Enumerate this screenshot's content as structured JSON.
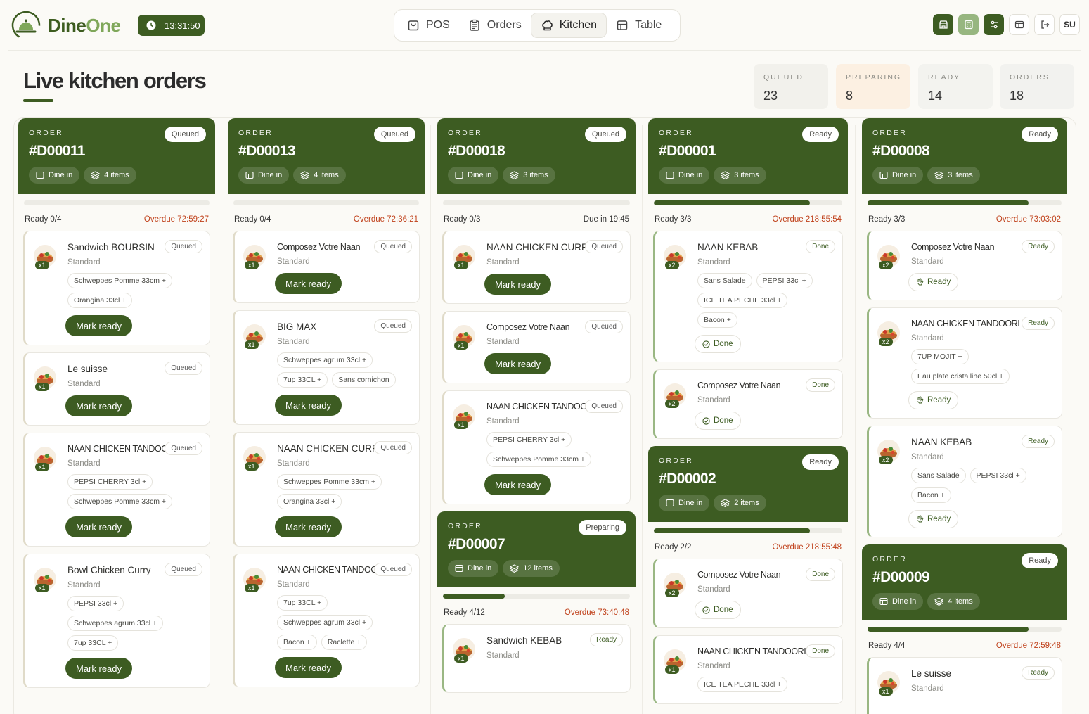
{
  "app": {
    "name_part1": "Dine",
    "name_part2": "One",
    "time": "13:31:50"
  },
  "nav": {
    "tabs": [
      {
        "label": "POS"
      },
      {
        "label": "Orders"
      },
      {
        "label": "Kitchen"
      },
      {
        "label": "Table"
      }
    ],
    "active": "Kitchen"
  },
  "user": {
    "initials": "SU"
  },
  "page": {
    "title": "Live kitchen orders"
  },
  "stats": [
    {
      "label": "QUEUED",
      "value": "23"
    },
    {
      "label": "PREPARING",
      "value": "8"
    },
    {
      "label": "READY",
      "value": "14"
    },
    {
      "label": "ORDERS",
      "value": "18"
    }
  ],
  "labels": {
    "order": "ORDER",
    "dine_in": "Dine in",
    "mark_ready": "Mark ready",
    "done": "Done",
    "ready": "Ready"
  },
  "columns": [
    {
      "orders": [
        {
          "number": "#D00011",
          "status": "Queued",
          "dine": "Dine in",
          "items_count": "4 items",
          "progress": 0,
          "ready": "Ready 0/4",
          "due": "Overdue 72:59:27",
          "overdue": true,
          "items": [
            {
              "name": "Sandwich BOURSIN",
              "variant": "Standard",
              "qty": "x1",
              "status": "Queued",
              "mods": [
                "Schweppes Pomme 33cm +",
                "Orangina 33cl +"
              ],
              "action": "Mark ready"
            },
            {
              "name": "Le suisse",
              "variant": "Standard",
              "qty": "x1",
              "status": "Queued",
              "mods": [],
              "action": "Mark ready"
            },
            {
              "name": "NAAN CHICKEN TANDOORI",
              "variant": "Standard",
              "qty": "x1",
              "status": "Queued",
              "mods": [
                "PEPSI CHERRY 3cl +",
                "Schweppes Pomme 33cm +"
              ],
              "action": "Mark ready"
            },
            {
              "name": "Bowl Chicken Curry",
              "variant": "Standard",
              "qty": "x1",
              "status": "Queued",
              "mods": [
                "PEPSI 33cl +",
                "Schweppes agrum 33cl +",
                "7up 33CL +"
              ],
              "action": "Mark ready"
            }
          ]
        }
      ]
    },
    {
      "orders": [
        {
          "number": "#D00013",
          "status": "Queued",
          "dine": "Dine in",
          "items_count": "4 items",
          "progress": 0,
          "ready": "Ready 0/4",
          "due": "Overdue 72:36:21",
          "overdue": true,
          "items": [
            {
              "name": "Composez Votre Naan",
              "variant": "Standard",
              "qty": "x1",
              "status": "Queued",
              "mods": [],
              "action": "Mark ready"
            },
            {
              "name": "BIG MAX",
              "variant": "Standard",
              "qty": "x1",
              "status": "Queued",
              "mods": [
                "Schweppes agrum 33cl +",
                "7up 33CL +",
                "Sans cornichon"
              ],
              "action": "Mark ready"
            },
            {
              "name": "NAAN CHICKEN CURRY",
              "variant": "Standard",
              "qty": "x1",
              "status": "Queued",
              "mods": [
                "Schweppes Pomme 33cm +",
                "Orangina 33cl +"
              ],
              "action": "Mark ready"
            },
            {
              "name": "NAAN CHICKEN TANDOORI",
              "variant": "Standard",
              "qty": "x1",
              "status": "Queued",
              "mods": [
                "7up 33CL +",
                "Schweppes agrum 33cl +",
                "Bacon +",
                "Raclette +"
              ],
              "action": "Mark ready"
            }
          ]
        }
      ]
    },
    {
      "orders": [
        {
          "number": "#D00018",
          "status": "Queued",
          "dine": "Dine in",
          "items_count": "3 items",
          "progress": 0,
          "ready": "Ready 0/3",
          "due": "Due in 19:45",
          "overdue": false,
          "items": [
            {
              "name": "NAAN CHICKEN CURRY",
              "variant": "Standard",
              "qty": "x1",
              "status": "Queued",
              "mods": [],
              "action": "Mark ready"
            },
            {
              "name": "Composez Votre Naan",
              "variant": "Standard",
              "qty": "x1",
              "status": "Queued",
              "mods": [],
              "action": "Mark ready"
            },
            {
              "name": "NAAN CHICKEN TANDOORI",
              "variant": "Standard",
              "qty": "x1",
              "status": "Queued",
              "mods": [
                "PEPSI CHERRY 3cl +",
                "Schweppes Pomme 33cm +"
              ],
              "action": "Mark ready"
            }
          ]
        },
        {
          "number": "#D00007",
          "status": "Preparing",
          "dine": "Dine in",
          "items_count": "12 items",
          "progress": 0.33,
          "ready": "Ready 4/12",
          "due": "Overdue 73:40:48",
          "overdue": true,
          "items": [
            {
              "name": "Sandwich KEBAB",
              "variant": "Standard",
              "qty": "x1",
              "status": "Ready",
              "mods": [],
              "action": ""
            }
          ]
        }
      ]
    },
    {
      "orders": [
        {
          "number": "#D00001",
          "status": "Ready",
          "dine": "Dine in",
          "items_count": "3 items",
          "progress": 0.83,
          "ready": "Ready 3/3",
          "due": "Overdue 218:55:54",
          "overdue": true,
          "items": [
            {
              "name": "NAAN KEBAB",
              "variant": "Standard",
              "qty": "x2",
              "status": "Done",
              "mods": [
                "Sans Salade",
                "PEPSI 33cl +",
                "ICE TEA PECHE 33cl +",
                "Bacon +"
              ],
              "action": "Done"
            },
            {
              "name": "Composez Votre Naan",
              "variant": "Standard",
              "qty": "x2",
              "status": "Done",
              "mods": [],
              "action": "Done"
            }
          ]
        },
        {
          "number": "#D00002",
          "status": "Ready",
          "dine": "Dine in",
          "items_count": "2 items",
          "progress": 0.83,
          "ready": "Ready 2/2",
          "due": "Overdue 218:55:48",
          "overdue": true,
          "items": [
            {
              "name": "Composez Votre Naan",
              "variant": "Standard",
              "qty": "x2",
              "status": "Done",
              "mods": [],
              "action": "Done"
            },
            {
              "name": "NAAN CHICKEN TANDOORI",
              "variant": "Standard",
              "qty": "x1",
              "status": "Done",
              "mods": [
                "ICE TEA PECHE 33cl +"
              ],
              "action": ""
            }
          ]
        }
      ]
    },
    {
      "orders": [
        {
          "number": "#D00008",
          "status": "Ready",
          "dine": "Dine in",
          "items_count": "3 items",
          "progress": 0.83,
          "ready": "Ready 3/3",
          "due": "Overdue 73:03:02",
          "overdue": true,
          "items": [
            {
              "name": "Composez Votre Naan",
              "variant": "Standard",
              "qty": "x2",
              "status": "Ready",
              "mods": [],
              "action": "Ready"
            },
            {
              "name": "NAAN CHICKEN TANDOORI",
              "variant": "Standard",
              "qty": "x2",
              "status": "Ready",
              "mods": [
                "7UP MOJIT +",
                "Eau plate cristalline 50cl +"
              ],
              "action": "Ready"
            },
            {
              "name": "NAAN KEBAB",
              "variant": "Standard",
              "qty": "x2",
              "status": "Ready",
              "mods": [
                "Sans Salade",
                "PEPSI 33cl +",
                "Bacon +"
              ],
              "action": "Ready"
            }
          ]
        },
        {
          "number": "#D00009",
          "status": "Ready",
          "dine": "Dine in",
          "items_count": "4 items",
          "progress": 0.83,
          "ready": "Ready 4/4",
          "due": "Overdue 72:59:48",
          "overdue": true,
          "items": [
            {
              "name": "Le suisse",
              "variant": "Standard",
              "qty": "x1",
              "status": "Ready",
              "mods": [],
              "action": ""
            }
          ]
        }
      ]
    }
  ],
  "colors": {
    "brand": "#3d5c22",
    "overdue": "#c0411b",
    "queued_stat": "#f2f1ec",
    "preparing_stat": "#fcf0e2"
  }
}
